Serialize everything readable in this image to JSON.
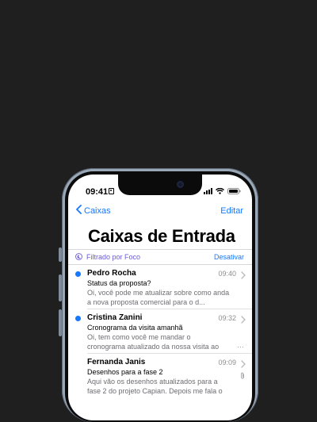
{
  "status_bar": {
    "time": "09:41"
  },
  "nav": {
    "back_label": "Caixas",
    "edit_label": "Editar"
  },
  "title": "Caixas de Entrada",
  "filter": {
    "label": "Filtrado por Foco",
    "action": "Desativar"
  },
  "messages": [
    {
      "sender": "Pedro Rocha",
      "time": "09:40",
      "subject": "Status da proposta?",
      "preview": "Oi, você pode me atualizar sobre como anda a nova proposta comercial para o d...",
      "unread": true
    },
    {
      "sender": "Cristina Zanini",
      "time": "09:32",
      "subject": "Cronograma da visita amanhã",
      "preview": "Oi, tem como você me mandar o cronograma atualizado da nossa visita ao cliente amanhã?",
      "unread": true
    },
    {
      "sender": "Fernanda Janis",
      "time": "09:09",
      "subject": "Desenhos para a fase 2",
      "preview": "Aqui vão os desenhos atualizados para a fase 2 do projeto Capian. Depois me fala o que...",
      "unread": false,
      "attachment": true
    }
  ],
  "colors": {
    "accent": "#1677ff",
    "focus": "#6b5bd6",
    "background": "#1f1f20"
  },
  "icons": [
    "chevron-left-icon",
    "person-id-icon",
    "signal-icon",
    "wifi-icon",
    "battery-icon",
    "focus-moon-icon",
    "chevron-right-icon",
    "paperclip-icon"
  ]
}
